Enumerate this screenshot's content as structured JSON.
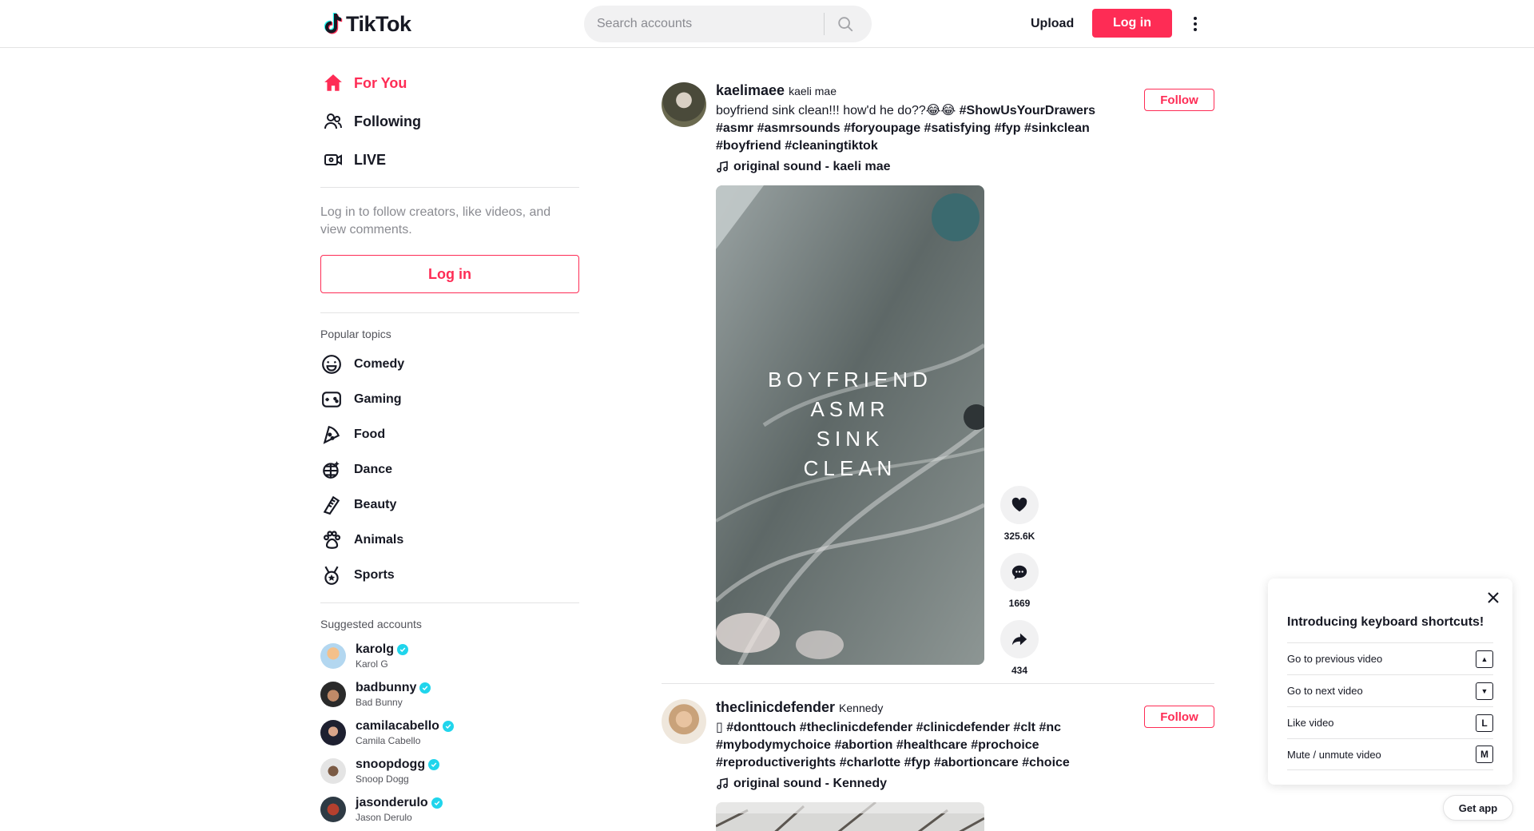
{
  "header": {
    "logo_text": "TikTok",
    "search_placeholder": "Search accounts",
    "upload_label": "Upload",
    "login_label": "Log in"
  },
  "sidebar": {
    "nav": [
      {
        "label": "For You",
        "icon": "home-icon",
        "active": true
      },
      {
        "label": "Following",
        "icon": "people-icon",
        "active": false
      },
      {
        "label": "LIVE",
        "icon": "live-icon",
        "active": false
      }
    ],
    "login_hint": "Log in to follow creators, like videos, and view comments.",
    "login_label": "Log in",
    "topics_title": "Popular topics",
    "topics": [
      {
        "label": "Comedy",
        "icon": "comedy-icon"
      },
      {
        "label": "Gaming",
        "icon": "gaming-icon"
      },
      {
        "label": "Food",
        "icon": "food-icon"
      },
      {
        "label": "Dance",
        "icon": "dance-icon"
      },
      {
        "label": "Beauty",
        "icon": "beauty-icon"
      },
      {
        "label": "Animals",
        "icon": "animals-icon"
      },
      {
        "label": "Sports",
        "icon": "sports-icon"
      }
    ],
    "accounts_title": "Suggested accounts",
    "accounts": [
      {
        "username": "karolg",
        "name": "Karol G"
      },
      {
        "username": "badbunny",
        "name": "Bad Bunny"
      },
      {
        "username": "camilacabello",
        "name": "Camila Cabello"
      },
      {
        "username": "snoopdogg",
        "name": "Snoop Dogg"
      },
      {
        "username": "jasonderulo",
        "name": "Jason Derulo"
      }
    ]
  },
  "posts": [
    {
      "username": "kaelimaee",
      "display_name": "kaeli mae",
      "caption_text": "boyfriend sink clean!!! how'd he do??😂😂 ",
      "tags": "#ShowUsYourDrawers #asmr #asmrsounds #foryoupage #satisfying #fyp #sinkclean #boyfriend #cleaningtiktok",
      "sound": "original sound - kaeli mae",
      "follow_label": "Follow",
      "overlay_lines": [
        "BOYFRIEND",
        "ASMR",
        "SINK",
        "CLEAN"
      ],
      "likes": "325.6K",
      "comments": "1669",
      "shares": "434"
    },
    {
      "username": "theclinicdefender",
      "display_name": "Kennedy",
      "caption_text": "▯ ",
      "tags": "#donttouch #theclinicdefender #clinicdefender #clt #nc #mybodymychoice #abortion #healthcare #prochoice #reproductiverights #charlotte #fyp #abortioncare #choice",
      "sound": "original sound - Kennedy",
      "follow_label": "Follow"
    }
  ],
  "keyboard_popup": {
    "title": "Introducing keyboard shortcuts!",
    "rows": [
      {
        "label": "Go to previous video",
        "key": "▲"
      },
      {
        "label": "Go to next video",
        "key": "▼"
      },
      {
        "label": "Like video",
        "key": "L"
      },
      {
        "label": "Mute / unmute video",
        "key": "M"
      }
    ]
  },
  "get_app_label": "Get app",
  "colors": {
    "brand": "#fe2c55",
    "verified": "#20d5ec",
    "text": "#161823"
  }
}
